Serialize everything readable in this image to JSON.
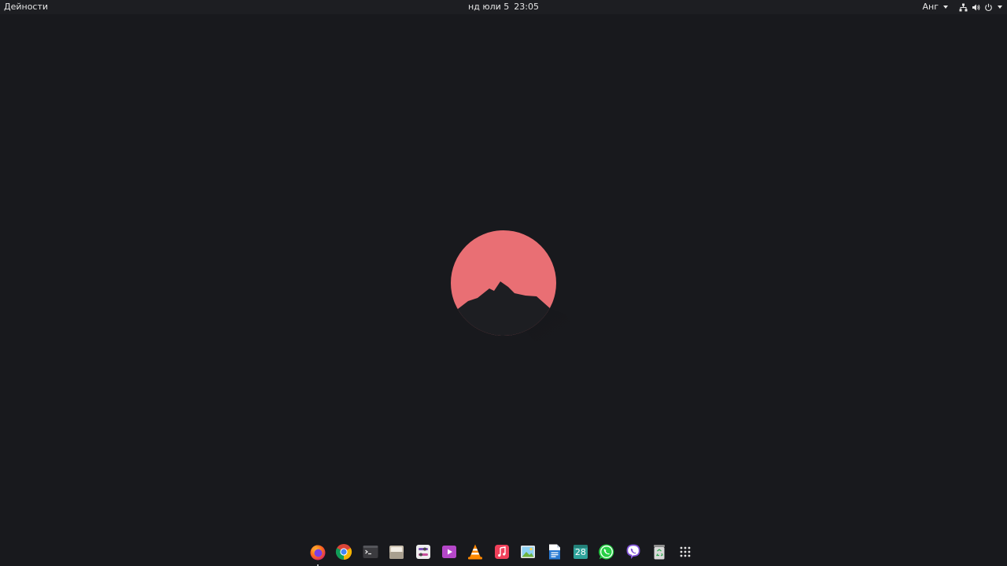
{
  "topbar": {
    "activities_label": "Дейности",
    "clock": {
      "date": "нд юли 5",
      "time": "23:05"
    },
    "keyboard_layout": "Анг",
    "system_icons": [
      "network-icon",
      "volume-icon",
      "power-icon"
    ]
  },
  "wallpaper": {
    "logo": "red-sun-mountain",
    "sun_color": "#e96f74",
    "background_color": "#18191d"
  },
  "dock": {
    "apps": [
      {
        "name": "Firefox",
        "icon": "firefox-icon",
        "running": true
      },
      {
        "name": "Chrome",
        "icon": "chrome-icon",
        "running": false
      },
      {
        "name": "Terminal",
        "icon": "terminal-icon",
        "running": false
      },
      {
        "name": "Files",
        "icon": "files-icon",
        "running": false
      },
      {
        "name": "Settings",
        "icon": "settings-icon",
        "running": false
      },
      {
        "name": "Videos",
        "icon": "videos-icon",
        "running": false
      },
      {
        "name": "VLC",
        "icon": "vlc-icon",
        "running": false
      },
      {
        "name": "Music",
        "icon": "music-icon",
        "running": false
      },
      {
        "name": "Image Viewer",
        "icon": "image-viewer-icon",
        "running": false
      },
      {
        "name": "Writer",
        "icon": "writer-icon",
        "running": false
      },
      {
        "name": "Calendar",
        "icon": "calendar-icon",
        "running": false,
        "badge_text": "28"
      },
      {
        "name": "WhatsApp",
        "icon": "whatsapp-icon",
        "running": false
      },
      {
        "name": "Viber",
        "icon": "viber-icon",
        "running": false
      },
      {
        "name": "Trash",
        "icon": "trash-icon",
        "running": false
      },
      {
        "name": "Show Applications",
        "icon": "app-grid-icon",
        "running": false
      }
    ]
  }
}
